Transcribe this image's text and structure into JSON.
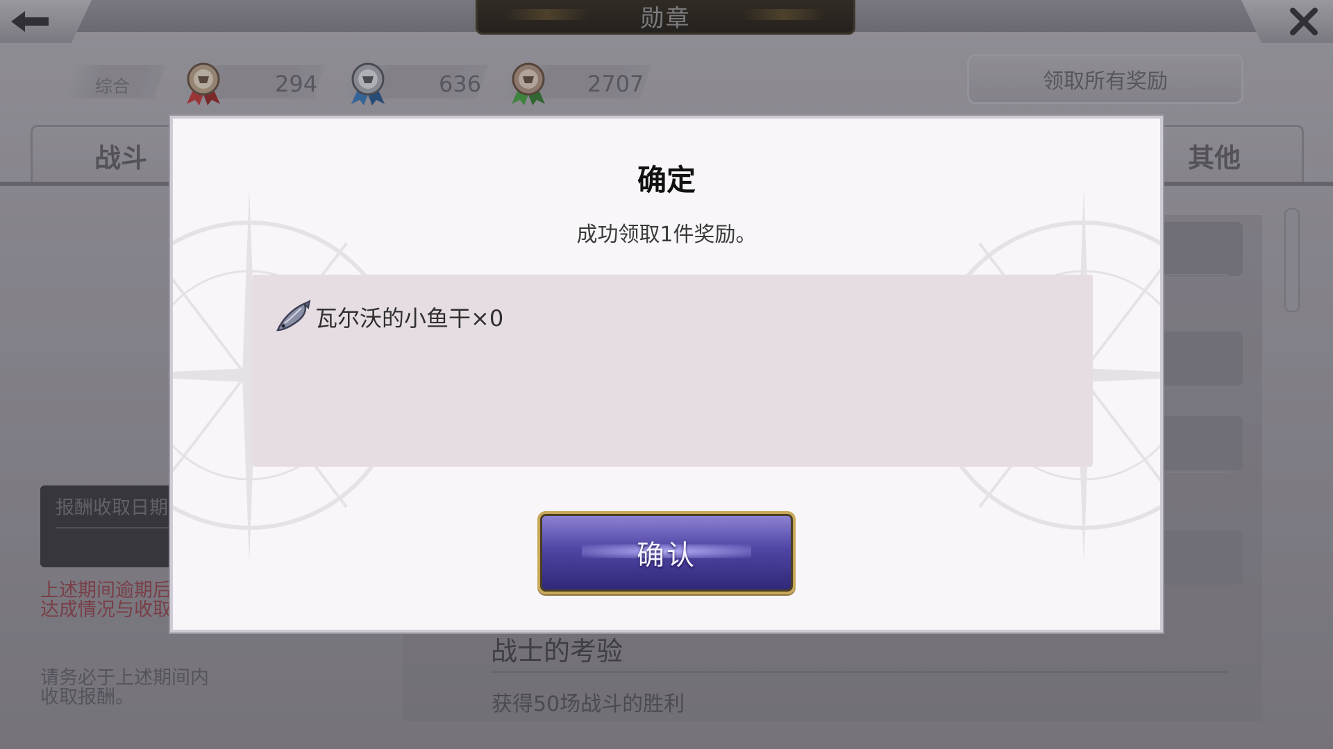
{
  "header": {
    "title": "勋章",
    "back_icon": "arrow-left-icon",
    "close_icon": "close-icon"
  },
  "stats": {
    "overall_label": "综合",
    "medals": [
      {
        "icon": "red-ribbon-medal-icon",
        "value": "294",
        "color": "#b63030"
      },
      {
        "icon": "blue-ribbon-medal-icon",
        "value": "636",
        "color": "#2f6fb0"
      },
      {
        "icon": "green-ribbon-medal-icon",
        "value": "2707",
        "color": "#3d9a3a"
      }
    ]
  },
  "claim_all_label": "领取所有奖励",
  "tabs": {
    "battle": "战斗",
    "other": "其他"
  },
  "left_panel": {
    "period_label": "报酬收取日期",
    "warning": "上述期间逾期后\n达成情况与收取",
    "note": "请务必于上述期间内\n收取报酬。"
  },
  "quest": {
    "title": "战士的考验",
    "description": "获得50场战斗的胜利"
  },
  "dialog": {
    "title": "确定",
    "message": "成功领取1件奖励。",
    "reward": {
      "icon": "fish-icon",
      "text": "瓦尔沃的小鱼干×0"
    },
    "confirm_label": "确认"
  }
}
